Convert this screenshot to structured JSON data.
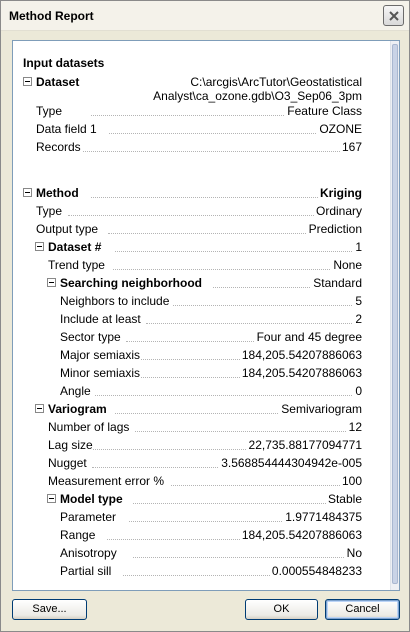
{
  "window": {
    "title": "Method Report"
  },
  "report": {
    "input_heading": "Input datasets",
    "dataset": {
      "label": "Dataset",
      "value_line1": "C:\\arcgis\\ArcTutor\\Geostatistical",
      "value_line2": "Analyst\\ca_ozone.gdb\\O3_Sep06_3pm",
      "rows": [
        {
          "label": "Type",
          "value": "Feature Class"
        },
        {
          "label": "Data field 1",
          "value": "OZONE"
        },
        {
          "label": "Records",
          "value": "167"
        }
      ]
    },
    "method": {
      "label": "Method",
      "value": "Kriging",
      "rows": [
        {
          "label": "Type",
          "value": "Ordinary"
        },
        {
          "label": "Output type",
          "value": "Prediction"
        }
      ],
      "dataset_num": {
        "label": "Dataset #",
        "value": "1",
        "trend": {
          "label": "Trend type",
          "value": "None"
        },
        "search": {
          "label": "Searching neighborhood",
          "value": "Standard",
          "rows": [
            {
              "label": "Neighbors to include",
              "value": "5"
            },
            {
              "label": "Include at least",
              "value": "2"
            },
            {
              "label": "Sector type",
              "value": "Four and 45 degree"
            },
            {
              "label": "Major semiaxis",
              "value": "184,205.54207886063"
            },
            {
              "label": "Minor semiaxis",
              "value": "184,205.54207886063"
            },
            {
              "label": "Angle",
              "value": "0"
            }
          ]
        },
        "variogram": {
          "label": "Variogram",
          "value": "Semivariogram",
          "rows": [
            {
              "label": "Number of lags",
              "value": "12"
            },
            {
              "label": "Lag size",
              "value": "22,735.88177094771"
            },
            {
              "label": "Nugget",
              "value": "3.568854444304942e-005"
            },
            {
              "label": "Measurement error %",
              "value": "100"
            }
          ],
          "model": {
            "label": "Model type",
            "value": "Stable",
            "rows": [
              {
                "label": "Parameter",
                "value": "1.9771484375"
              },
              {
                "label": "Range",
                "value": "184,205.54207886063"
              },
              {
                "label": "Anisotropy",
                "value": "No"
              },
              {
                "label": "Partial sill",
                "value": "0.000554848233"
              }
            ]
          }
        }
      }
    }
  },
  "buttons": {
    "save": "Save...",
    "ok": "OK",
    "cancel": "Cancel"
  },
  "icons": {
    "close": "close-icon",
    "toggle": "collapse-minus-icon"
  }
}
